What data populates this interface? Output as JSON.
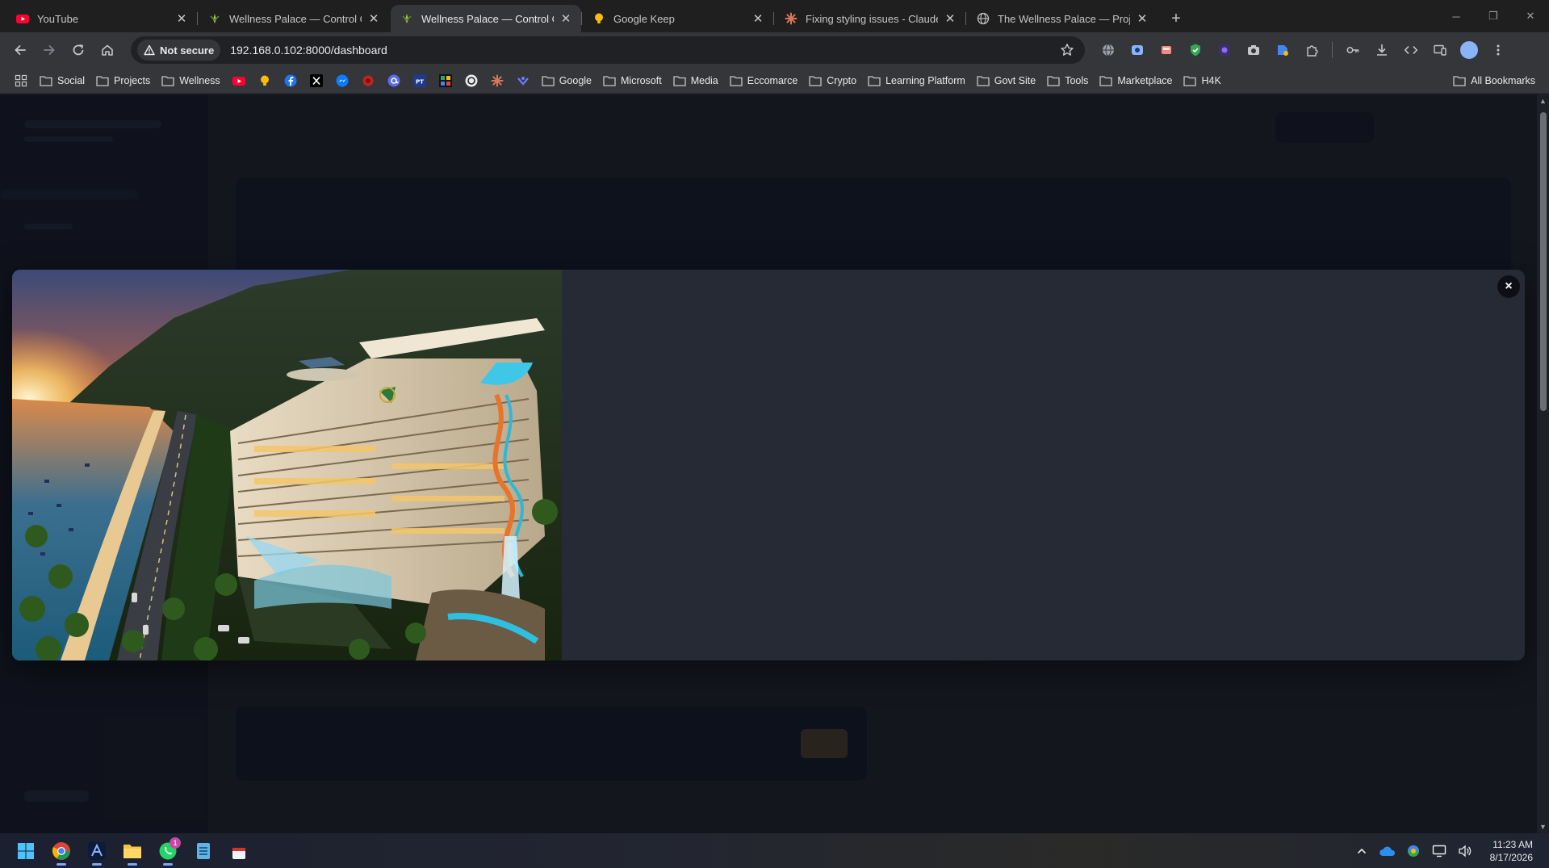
{
  "browser": {
    "tabs": [
      {
        "title": "YouTube",
        "favicon": "youtube-icon",
        "active": false
      },
      {
        "title": "Wellness Palace — Control Cen",
        "favicon": "wellness-palace-icon",
        "active": false
      },
      {
        "title": "Wellness Palace — Control Cen",
        "favicon": "wellness-palace-icon",
        "active": true
      },
      {
        "title": "Google Keep",
        "favicon": "google-keep-icon",
        "active": false
      },
      {
        "title": "Fixing styling issues - Claude",
        "favicon": "claude-icon",
        "active": false
      },
      {
        "title": "The Wellness Palace — Project",
        "favicon": "globe-icon",
        "active": false
      }
    ],
    "security_label": "Not secure",
    "url": "192.168.0.102:8000/dashboard"
  },
  "bookmarks": {
    "folders": [
      "Social",
      "Projects",
      "Wellness",
      "Google",
      "Microsoft",
      "Media",
      "Eccomarce",
      "Crypto",
      "Learning Platform",
      "Govt Site",
      "Tools",
      "Marketplace",
      "H4K"
    ],
    "site_icons": [
      "youtube-icon",
      "google-keep-icon",
      "facebook-icon",
      "x-icon",
      "messenger-icon",
      "red-app-icon",
      "threads-icon",
      "pt-icon",
      "grid-app-icon",
      "chatgpt-icon",
      "claude-icon",
      "blue-app-icon"
    ],
    "pt_label": "PT",
    "all_bookmarks": "All Bookmarks"
  },
  "modal": {
    "image_name": "wellness-palace-hotel-image",
    "close_label": "×"
  },
  "taskbar": {
    "whatsapp_badge": "1",
    "time": "11:23 AM",
    "date": "8/17/2026"
  },
  "colors": {
    "accent": "#8ab4f8",
    "page_background": "#13151c",
    "modal_background": "#262a35"
  }
}
